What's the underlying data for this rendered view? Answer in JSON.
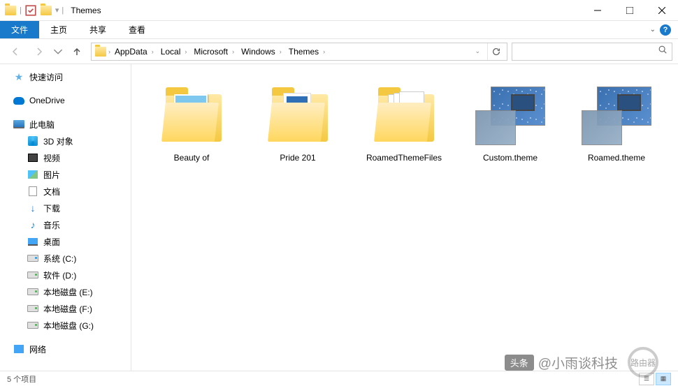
{
  "window": {
    "title": "Themes"
  },
  "ribbon": {
    "file": "文件",
    "tabs": [
      "主页",
      "共享",
      "查看"
    ]
  },
  "breadcrumbs": [
    "AppData",
    "Local",
    "Microsoft",
    "Windows",
    "Themes"
  ],
  "nav": {
    "quick_access": "快速访问",
    "onedrive": "OneDrive",
    "this_pc": "此电脑",
    "items": [
      {
        "label": "3D 对象",
        "icon": "obj3d"
      },
      {
        "label": "视频",
        "icon": "video"
      },
      {
        "label": "图片",
        "icon": "pic"
      },
      {
        "label": "文档",
        "icon": "doc"
      },
      {
        "label": "下载",
        "icon": "dl"
      },
      {
        "label": "音乐",
        "icon": "music"
      },
      {
        "label": "桌面",
        "icon": "desk"
      },
      {
        "label": "系统 (C:)",
        "icon": "drive-sys"
      },
      {
        "label": "软件 (D:)",
        "icon": "drive"
      },
      {
        "label": "本地磁盘 (E:)",
        "icon": "drive"
      },
      {
        "label": "本地磁盘 (F:)",
        "icon": "drive"
      },
      {
        "label": "本地磁盘 (G:)",
        "icon": "drive"
      }
    ],
    "network": "网络"
  },
  "files": [
    {
      "name": "Beauty of",
      "type": "folder-photos"
    },
    {
      "name": "Pride 201",
      "type": "folder-pride"
    },
    {
      "name": "RoamedThemeFiles",
      "type": "folder-pages"
    },
    {
      "name": "Custom.theme",
      "type": "theme"
    },
    {
      "name": "Roamed.theme",
      "type": "theme"
    }
  ],
  "status": {
    "count": "5 个项目"
  },
  "watermark": {
    "badge": "头条",
    "text": "@小雨谈科技",
    "logo": "路由器"
  }
}
